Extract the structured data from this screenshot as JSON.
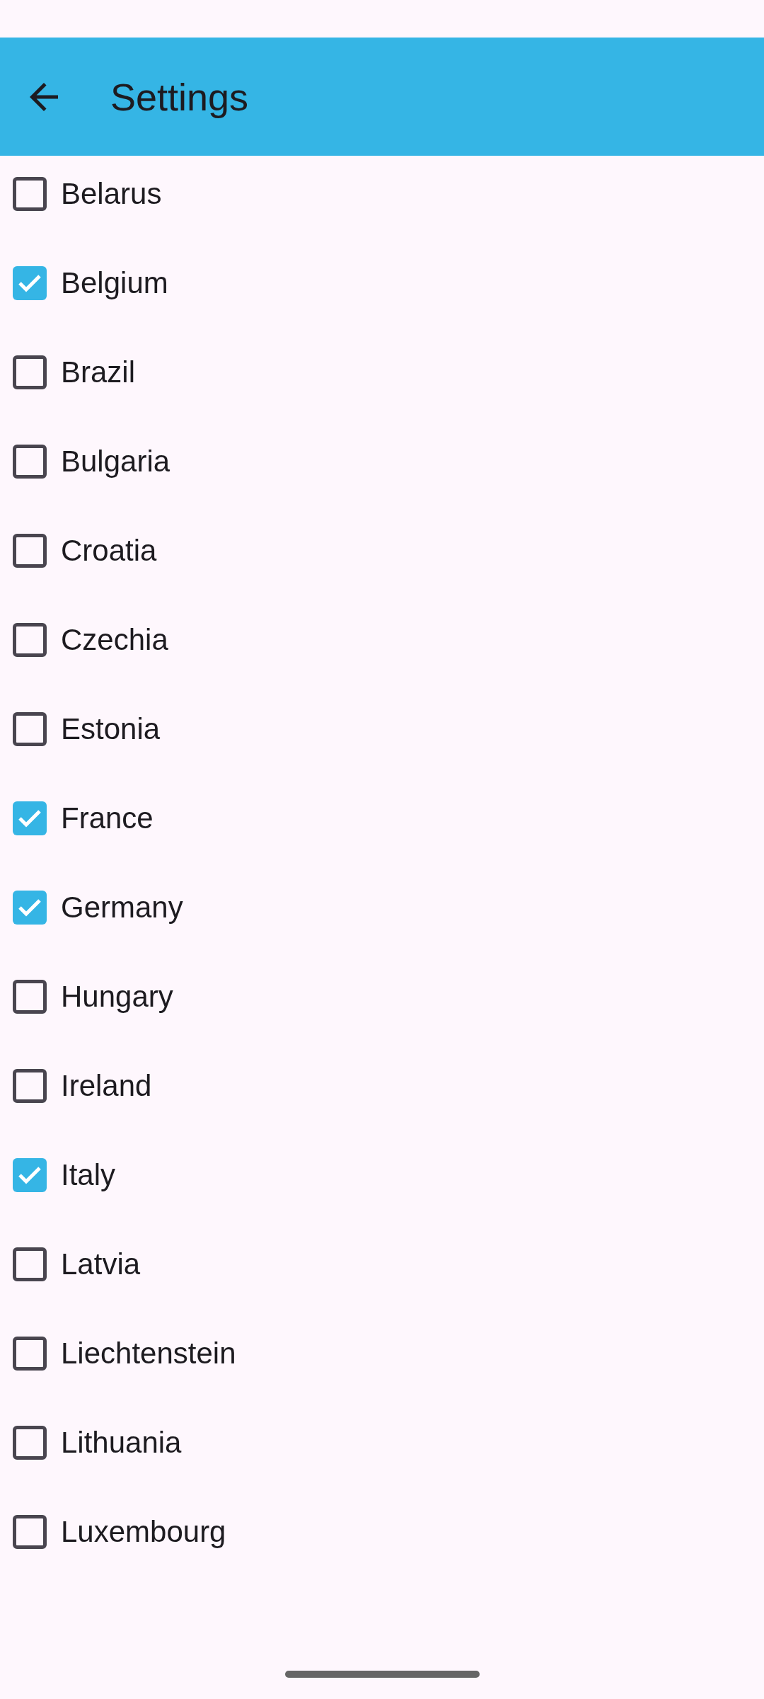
{
  "app_bar": {
    "title": "Settings"
  },
  "countries": [
    {
      "label": "Belarus",
      "checked": false
    },
    {
      "label": "Belgium",
      "checked": true
    },
    {
      "label": "Brazil",
      "checked": false
    },
    {
      "label": "Bulgaria",
      "checked": false
    },
    {
      "label": "Croatia",
      "checked": false
    },
    {
      "label": "Czechia",
      "checked": false
    },
    {
      "label": "Estonia",
      "checked": false
    },
    {
      "label": "France",
      "checked": true
    },
    {
      "label": "Germany",
      "checked": true
    },
    {
      "label": "Hungary",
      "checked": false
    },
    {
      "label": "Ireland",
      "checked": false
    },
    {
      "label": "Italy",
      "checked": true
    },
    {
      "label": "Latvia",
      "checked": false
    },
    {
      "label": "Liechtenstein",
      "checked": false
    },
    {
      "label": "Lithuania",
      "checked": false
    },
    {
      "label": "Luxembourg",
      "checked": false
    }
  ]
}
